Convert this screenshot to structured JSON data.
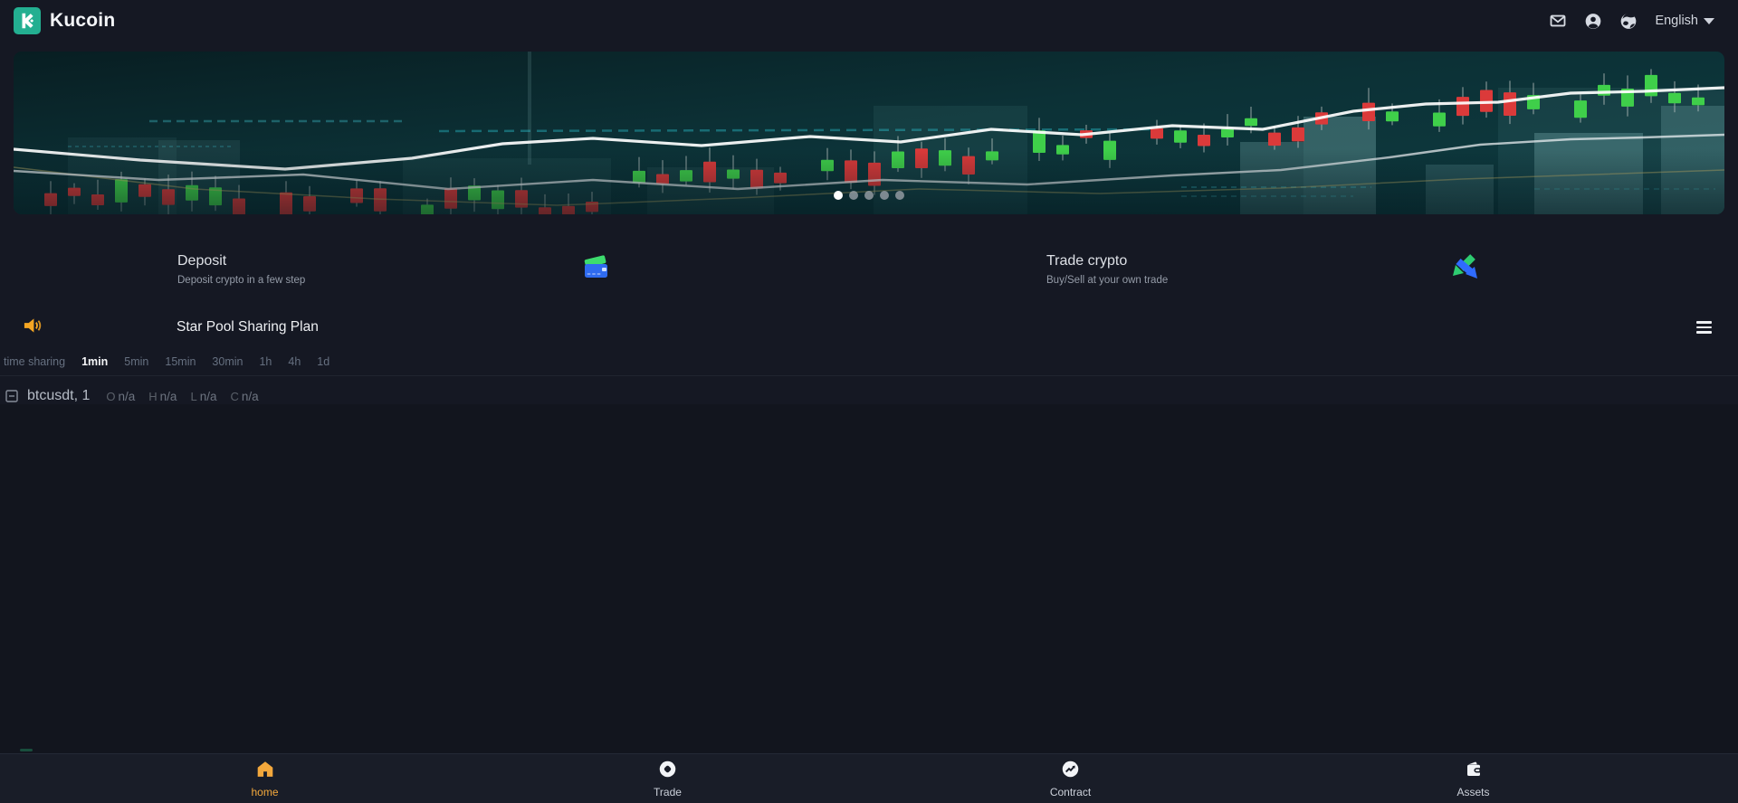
{
  "header": {
    "brand": "Kucoin",
    "language": "English"
  },
  "banner": {
    "dots_count": 5,
    "active_dot_index": 0
  },
  "quick_actions": [
    {
      "title": "Deposit",
      "subtitle": "Deposit crypto in a few step",
      "icon": "credit-card-icon"
    },
    {
      "title": "Trade crypto",
      "subtitle": "Buy/Sell at your own trade",
      "icon": "swap-arrows-icon"
    }
  ],
  "announcement": {
    "title": "Star Pool Sharing Plan"
  },
  "timeframes": {
    "items": [
      "time sharing",
      "1min",
      "5min",
      "15min",
      "30min",
      "1h",
      "4h",
      "1d"
    ],
    "active": "1min"
  },
  "chart_legend": {
    "symbol": "btcusdt, 1",
    "fields": [
      {
        "label": "O",
        "value": "n/a"
      },
      {
        "label": "H",
        "value": "n/a"
      },
      {
        "label": "L",
        "value": "n/a"
      },
      {
        "label": "C",
        "value": "n/a"
      }
    ]
  },
  "bottom_nav": [
    {
      "label": "home",
      "active": true
    },
    {
      "label": "Trade",
      "active": false
    },
    {
      "label": "Contract",
      "active": false
    },
    {
      "label": "Assets",
      "active": false
    }
  ],
  "colors": {
    "brand_green": "#23af91",
    "active_orange": "#f3a83c",
    "candle_green": "#3fcf4a",
    "candle_red": "#db3a3a",
    "announcement_speaker": "#f5a623"
  }
}
